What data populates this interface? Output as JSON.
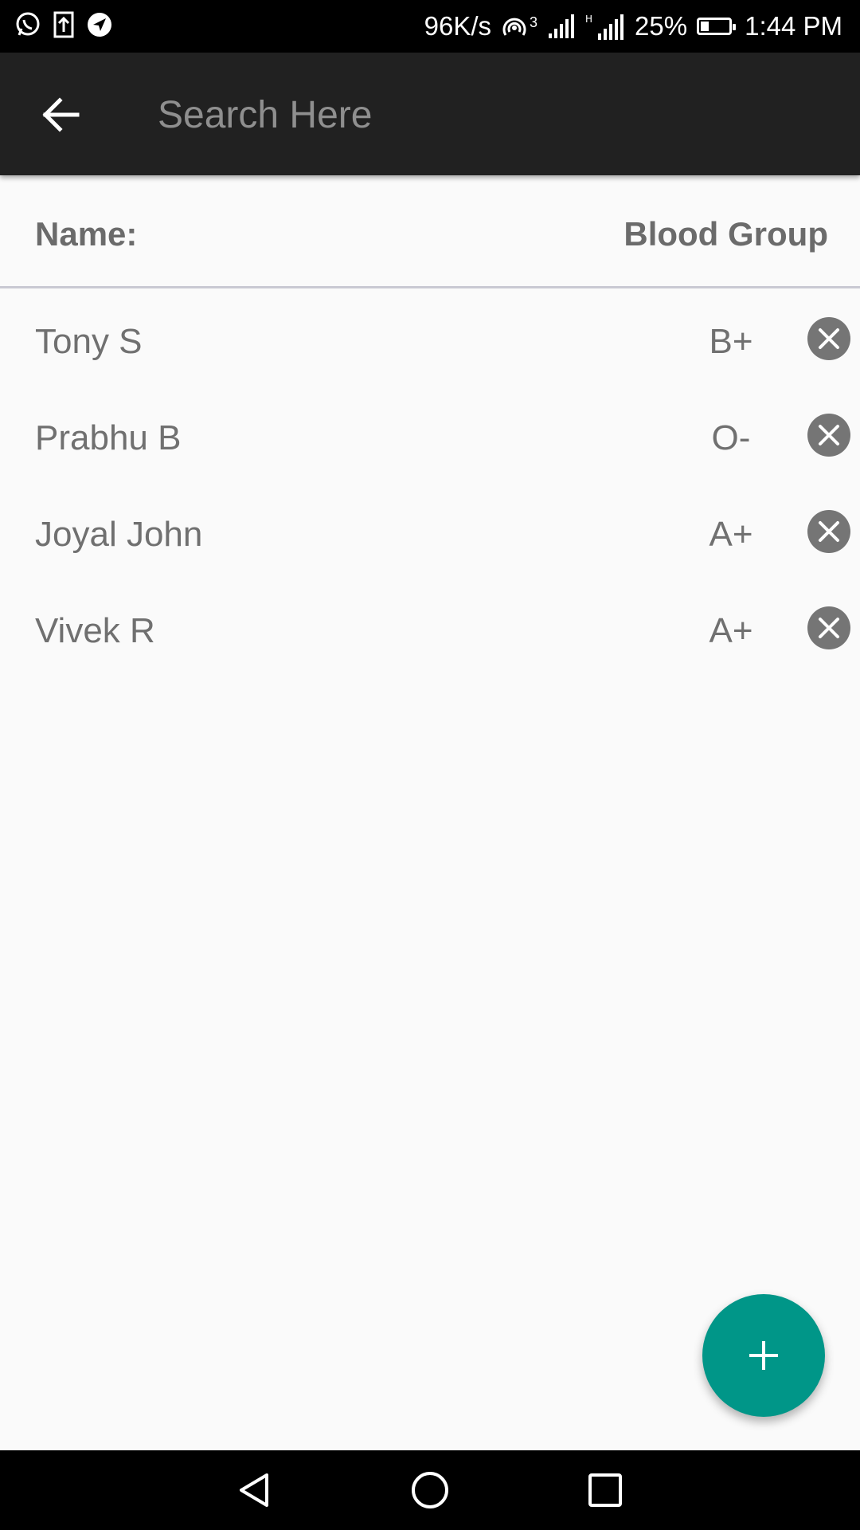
{
  "status_bar": {
    "net_speed": "96K/s",
    "hotspot_badge": "3",
    "battery": "25%",
    "time": "1:44 PM"
  },
  "toolbar": {
    "search_placeholder": "Search Here",
    "search_value": ""
  },
  "header": {
    "name_label": "Name:",
    "blood_group_label": "Blood Group"
  },
  "donors": [
    {
      "name": "Tony S",
      "blood_group": "B+"
    },
    {
      "name": "Prabhu B",
      "blood_group": "O-"
    },
    {
      "name": "Joyal John",
      "blood_group": "A+"
    },
    {
      "name": "Vivek R",
      "blood_group": "A+"
    }
  ],
  "icons": {
    "back": "arrow-back-icon",
    "remove": "close-circle-icon",
    "fab": "plus-icon",
    "nav_back": "triangle-back-icon",
    "nav_home": "circle-home-icon",
    "nav_recents": "square-recents-icon"
  },
  "colors": {
    "toolbar": "#212121",
    "fab": "#009688",
    "text": "#707070",
    "remove_button": "#757575"
  }
}
